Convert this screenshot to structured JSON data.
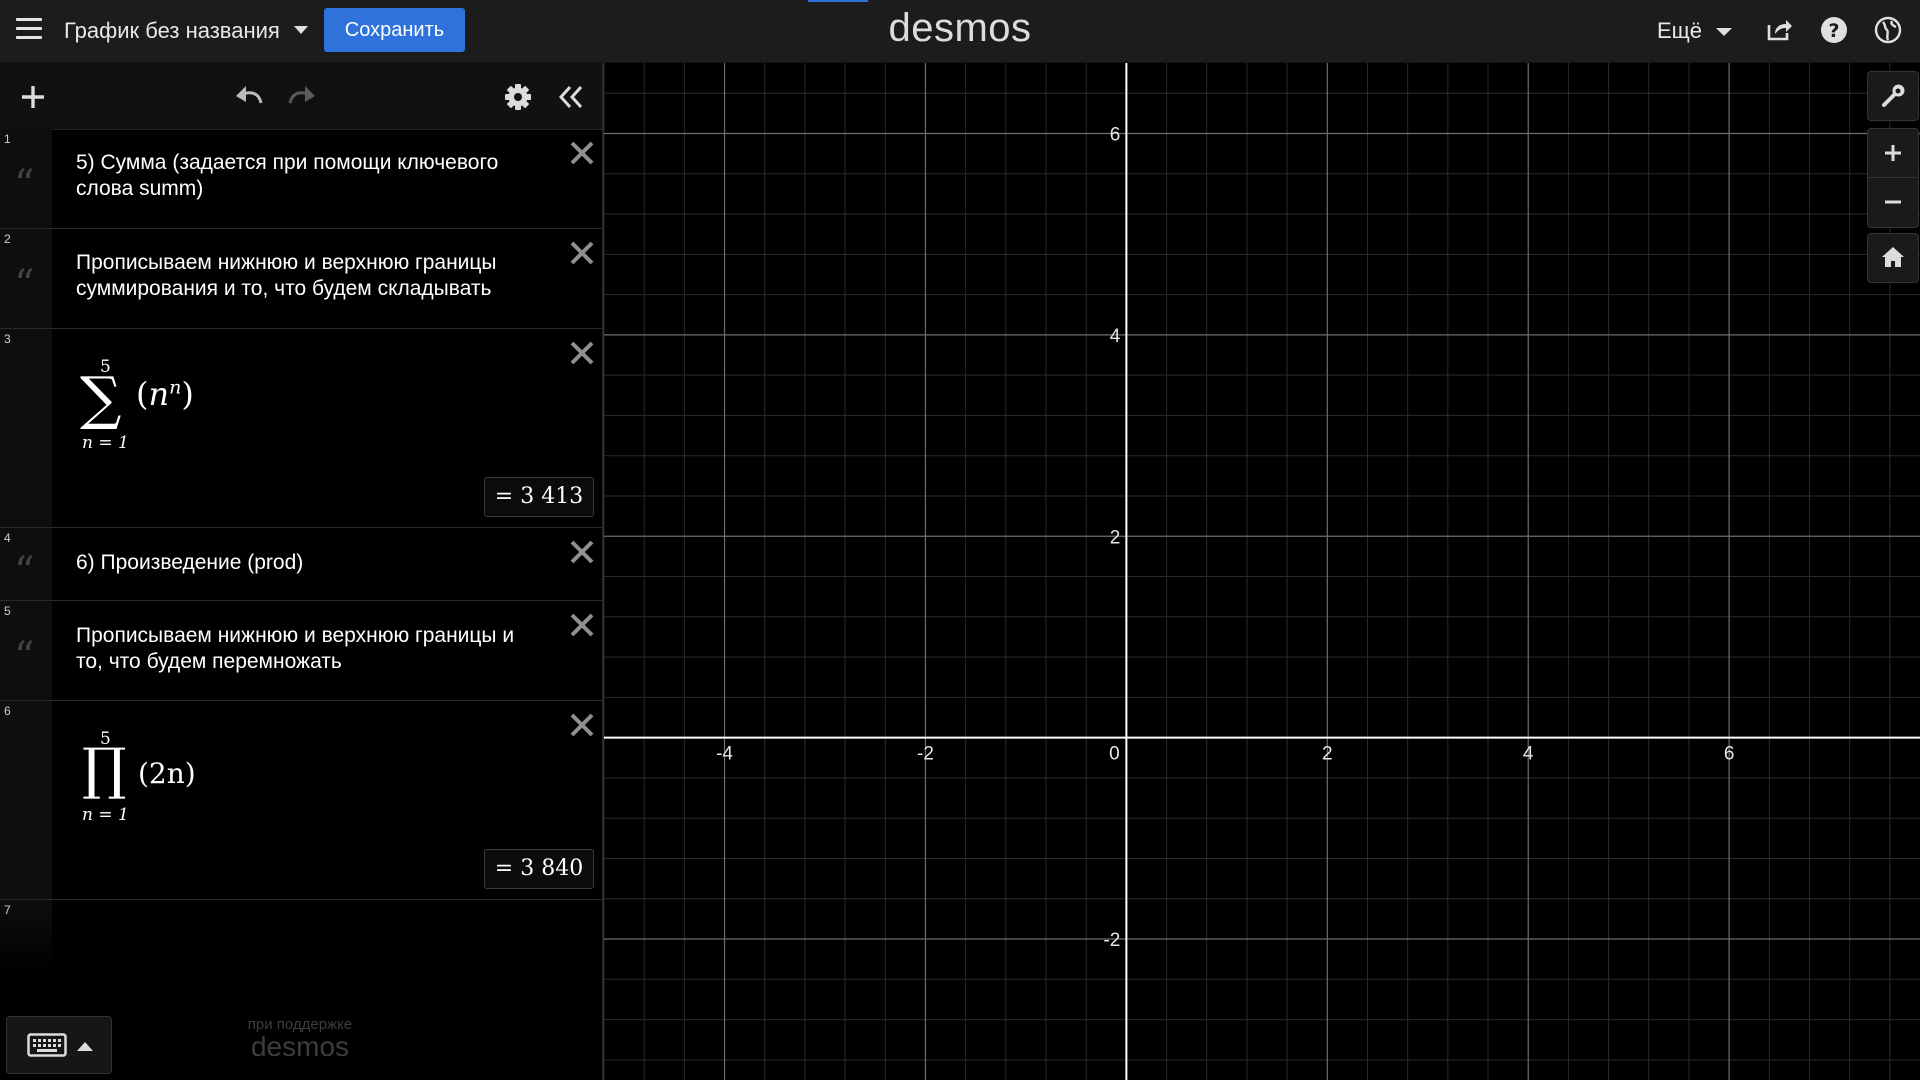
{
  "header": {
    "graph_title": "График без названия",
    "save_label": "Сохранить",
    "logo": "desmos",
    "more_label": "Ещё"
  },
  "expressions": [
    {
      "index": "1",
      "kind": "note",
      "text": "5) Сумма (задается при помощи ключевого слова summ)"
    },
    {
      "index": "2",
      "kind": "note",
      "text": "Прописываем нижнюю и верхнюю границы суммирования и то, что будем складывать"
    },
    {
      "index": "3",
      "kind": "math",
      "operator": "∑",
      "upper": "5",
      "lower": "n = 1",
      "body_open": "(",
      "body_base": "n",
      "body_exp": "n",
      "body_close": ")",
      "result": "=  3 413"
    },
    {
      "index": "4",
      "kind": "note",
      "text": "6) Произведение (prod)"
    },
    {
      "index": "5",
      "kind": "note",
      "text": "Прописываем нижнюю и верхнюю границы и то, что будем перемножать"
    },
    {
      "index": "6",
      "kind": "math",
      "operator": "∏",
      "upper": "5",
      "lower": "n = 1",
      "body": "(2n)",
      "result": "=  3 840"
    },
    {
      "index": "7",
      "kind": "empty"
    }
  ],
  "footer": {
    "powered_by": "при поддержке",
    "powered_brand": "desmos"
  },
  "graph": {
    "x_ticks": [
      "-4",
      "-2",
      "0",
      "2",
      "4",
      "6"
    ],
    "y_ticks": [
      "6",
      "4",
      "2",
      "-2"
    ],
    "x_range": [
      -5.2,
      7.9
    ],
    "y_range": [
      -3.4,
      6.7
    ],
    "grid": "major every 2, minor every 0.4",
    "axis_color": "#ffffff",
    "background_color": "#000000"
  },
  "colors": {
    "accent": "#2f72dc",
    "header_bg": "#1c1c1c"
  },
  "icons": {
    "menu": "hamburger-icon",
    "share": "share-icon",
    "help": "help-icon",
    "language": "globe-icon",
    "add": "plus-icon",
    "undo": "undo-icon",
    "redo": "redo-icon",
    "settings": "gear-icon",
    "collapse": "double-chevron-left-icon",
    "delete": "close-icon",
    "note": "quote-icon",
    "keyboard": "keyboard-icon",
    "wrench": "wrench-icon",
    "zoom_in": "plus-icon",
    "zoom_out": "minus-icon",
    "home": "home-icon"
  }
}
